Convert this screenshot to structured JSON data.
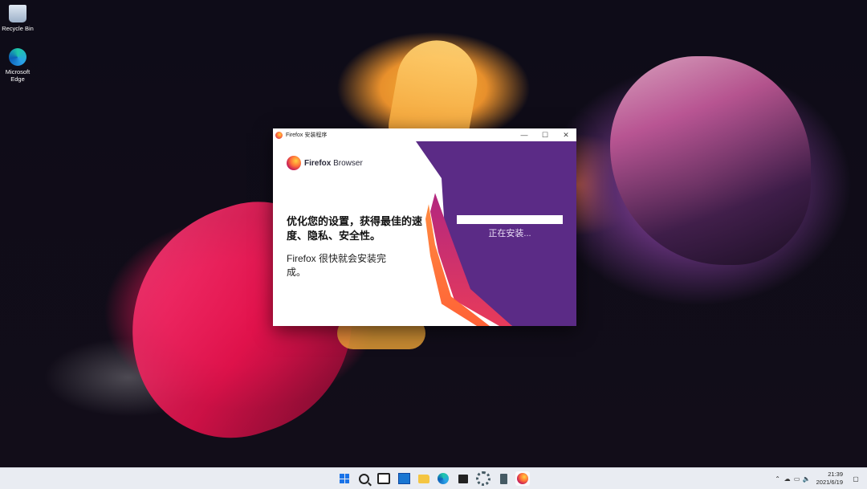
{
  "desktop": {
    "icons": [
      {
        "label": "Recycle Bin"
      },
      {
        "label": "Microsoft Edge"
      }
    ]
  },
  "installer": {
    "title": "Firefox 安装程序",
    "brand_name_bold": "Firefox",
    "brand_name_rest": " Browser",
    "heading": "优化您的设置，获得最佳的速度、隐私、安全性。",
    "subtext": "Firefox 很快就会安装完成。",
    "status": "正在安装...",
    "progress": 1.0,
    "window_buttons": {
      "minimize": "—",
      "maximize": "☐",
      "close": "✕"
    }
  },
  "taskbar": {
    "clock_time": "21:39",
    "clock_date": "2021/6/19",
    "tray_icons": [
      "chevron-up-icon",
      "cloud-icon",
      "network-icon",
      "volume-icon"
    ],
    "apps": [
      "start",
      "search",
      "task-view",
      "widgets",
      "file-explorer",
      "edge",
      "store",
      "settings",
      "calculator",
      "firefox"
    ]
  }
}
